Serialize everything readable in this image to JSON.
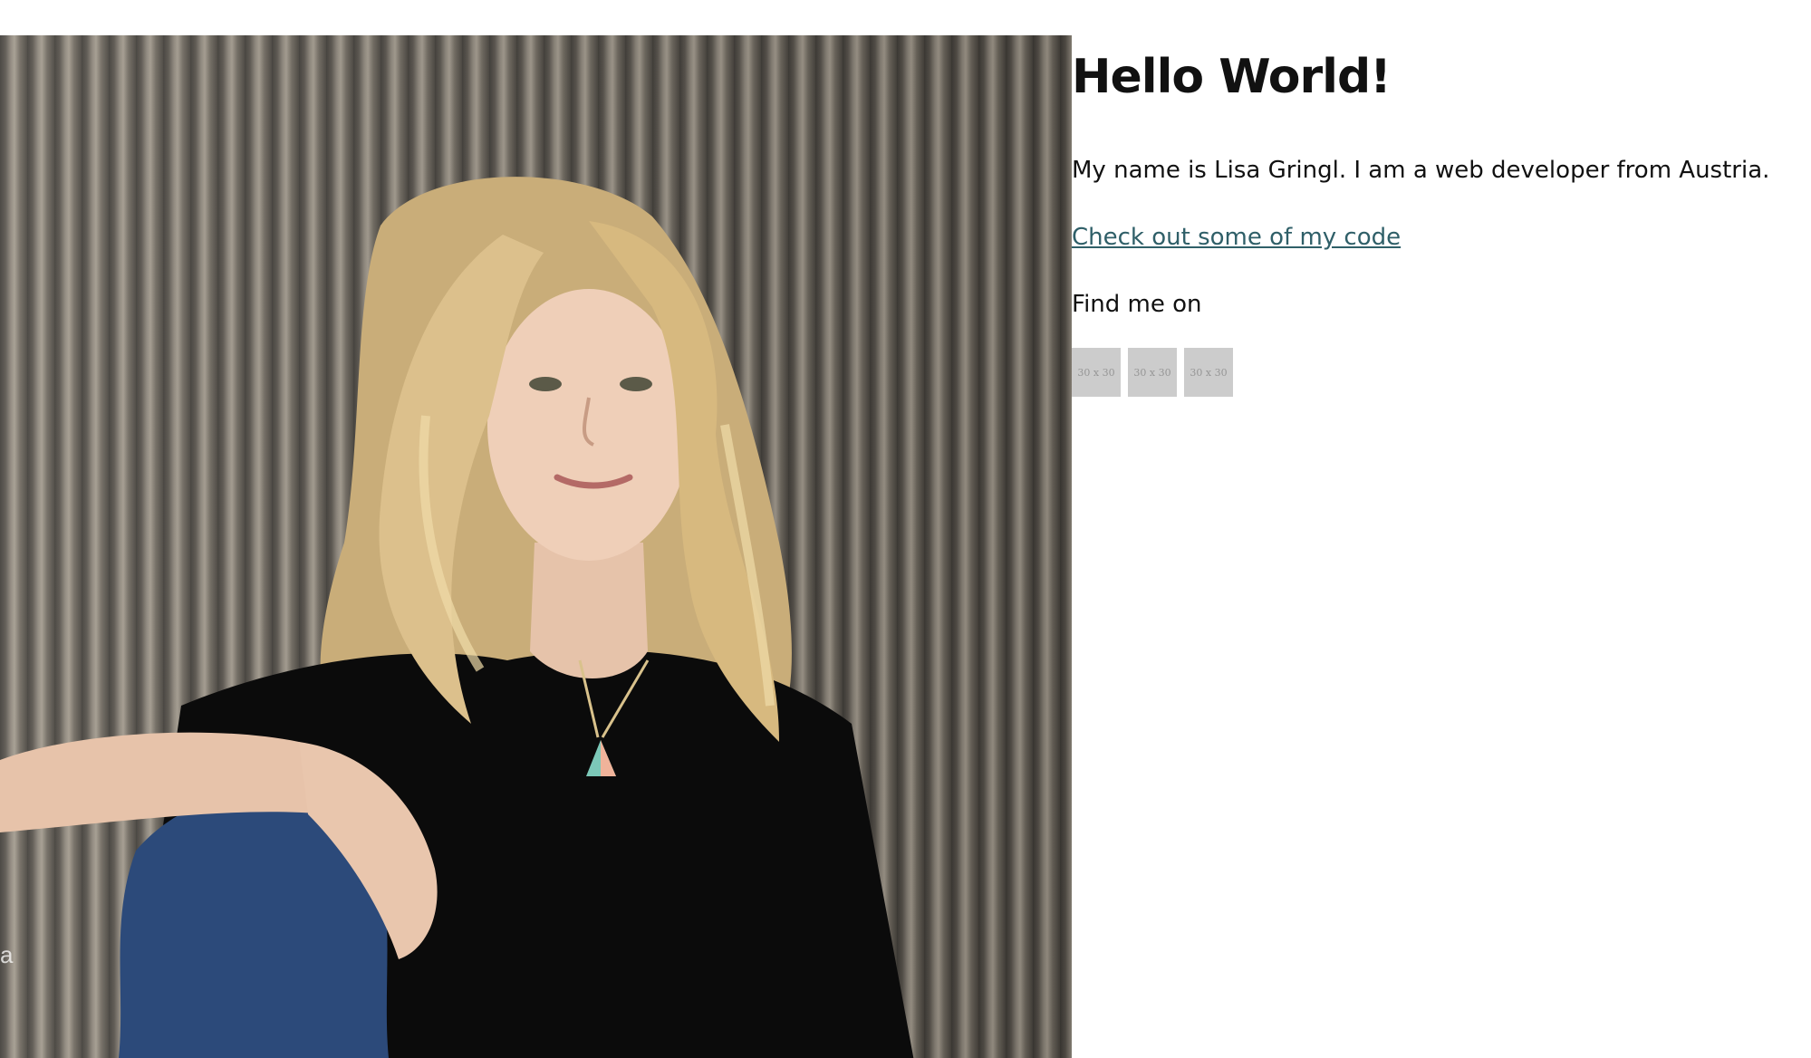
{
  "photo": {
    "alt": "Portrait of Lisa Gringl",
    "corner_letter": "a"
  },
  "header": {
    "title": "Hello World!"
  },
  "intro": {
    "text": "My name is Lisa Gringl. I am a web developer from Austria."
  },
  "links": {
    "code_link_label": "Check out some of my code",
    "code_link_color": "#2f5f68"
  },
  "social": {
    "label": "Find me on",
    "icons": [
      {
        "name": "placeholder-icon",
        "text": "30 x 30"
      },
      {
        "name": "placeholder-icon",
        "text": "30 x 30"
      },
      {
        "name": "placeholder-icon",
        "text": "30 x 30"
      }
    ]
  }
}
